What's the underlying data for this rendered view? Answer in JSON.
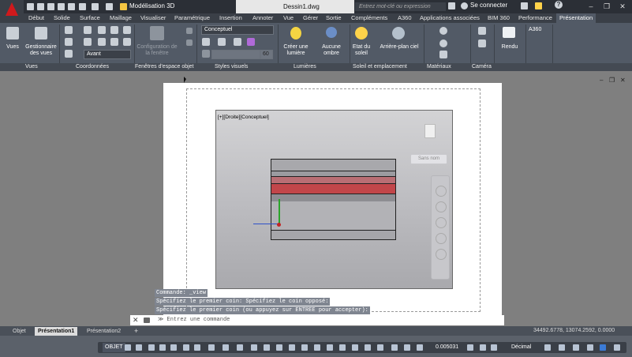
{
  "titlebar": {
    "workspace": "Modélisation 3D",
    "document": "Dessin1.dwg",
    "search_placeholder": "Entrez mot-clé ou expression",
    "signin": "Se connecter",
    "help": "?",
    "minimize": "–",
    "restore": "❐",
    "close": "✕"
  },
  "tabs": [
    "Début",
    "Solide",
    "Surface",
    "Maillage",
    "Visualiser",
    "Paramétrique",
    "Insertion",
    "Annoter",
    "Vue",
    "Gérer",
    "Sortie",
    "Compléments",
    "A360",
    "Applications associées",
    "BIM 360",
    "Performance",
    "Présentation"
  ],
  "active_tab": "Présentation",
  "ribbon": {
    "views": "Vues",
    "view_manager": "Gestionnaire des vues",
    "ucs_dropdown": "Avant",
    "viewport_config": "Configuration de la fenêtre",
    "visual_style": "Conceptuel",
    "opacity_value": "60",
    "create_light": "Créer une lumière",
    "no_shadow": "Aucune ombre",
    "sun_status": "Etat du soleil",
    "sky_background": "Arrière-plan ciel",
    "render": "Rendu",
    "a360": "A360"
  },
  "panels": {
    "views": "Vues",
    "coordinates": "Coordonnées",
    "model_viewports": "Fenêtres d'espace objet",
    "visual_styles": "Styles visuels",
    "lights": "Lumières",
    "sun_location": "Soleil et emplacement",
    "materials": "Matériaux",
    "camera": "Caméra"
  },
  "viewport": {
    "label": "[+][Droite][Conceptuel]",
    "unnamed": "Sans nom"
  },
  "command": {
    "line1": "Commande: _view",
    "line2": "Spécifiez le premier coin: Spécifiez le coin opposé:",
    "line3": "Spécifiez le premier coin (ou appuyez sur ENTREE pour accepter):",
    "placeholder": "Entrez une commande",
    "prompt": "≫"
  },
  "layout_tabs": [
    "Objet",
    "Présentation1",
    "Présentation2"
  ],
  "active_layout": "Présentation1",
  "add_tab": "+",
  "coordinates": "34492.6778, 13074.2592, 0.0000",
  "status": {
    "objet": "OBJET",
    "scale_value": "0.005031",
    "units": "Décimal"
  },
  "colors": {
    "title_bg": "#2b2f36",
    "ribbon_bg": "#525a66",
    "accent_red": "#d0191c",
    "band_red": "#c2464a"
  }
}
